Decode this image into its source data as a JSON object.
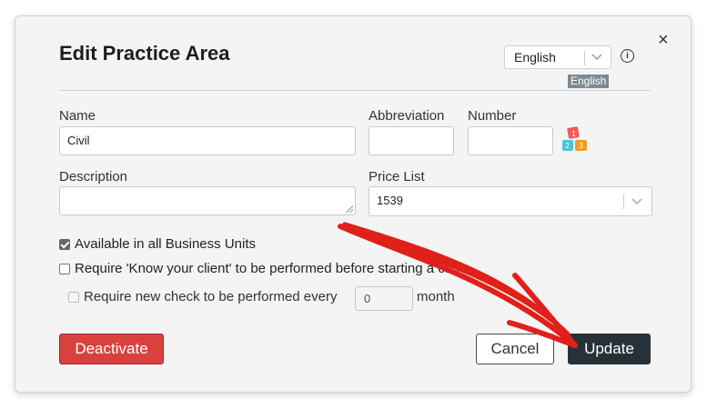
{
  "dialog": {
    "title": "Edit Practice Area",
    "close_glyph": "×",
    "language_select": {
      "value": "English",
      "chevron_icon": "chevron-down-icon"
    },
    "info_icon": "i",
    "language_badge": "English"
  },
  "form": {
    "name_label": "Name",
    "name_value": "Civil",
    "abbreviation_label": "Abbreviation",
    "abbreviation_value": "",
    "number_label": "Number",
    "number_value": "",
    "description_label": "Description",
    "description_value": "",
    "pricelist_label": "Price List",
    "pricelist_value": "1539"
  },
  "options": {
    "available_all_units": {
      "label": "Available in all Business Units",
      "checked": true
    },
    "require_kyc": {
      "label": "Require 'Know your client' to be performed before starting a case",
      "checked": false
    },
    "require_new_check": {
      "label": "Require new check to be performed every",
      "checked": false,
      "disabled": true,
      "months_value": "0",
      "unit": "month"
    }
  },
  "buttons": {
    "deactivate": "Deactivate",
    "cancel": "Cancel",
    "update": "Update"
  },
  "colors": {
    "deactivate_bg": "#d9413f",
    "update_bg": "#263238",
    "annotation_arrow": "#e0201b"
  }
}
